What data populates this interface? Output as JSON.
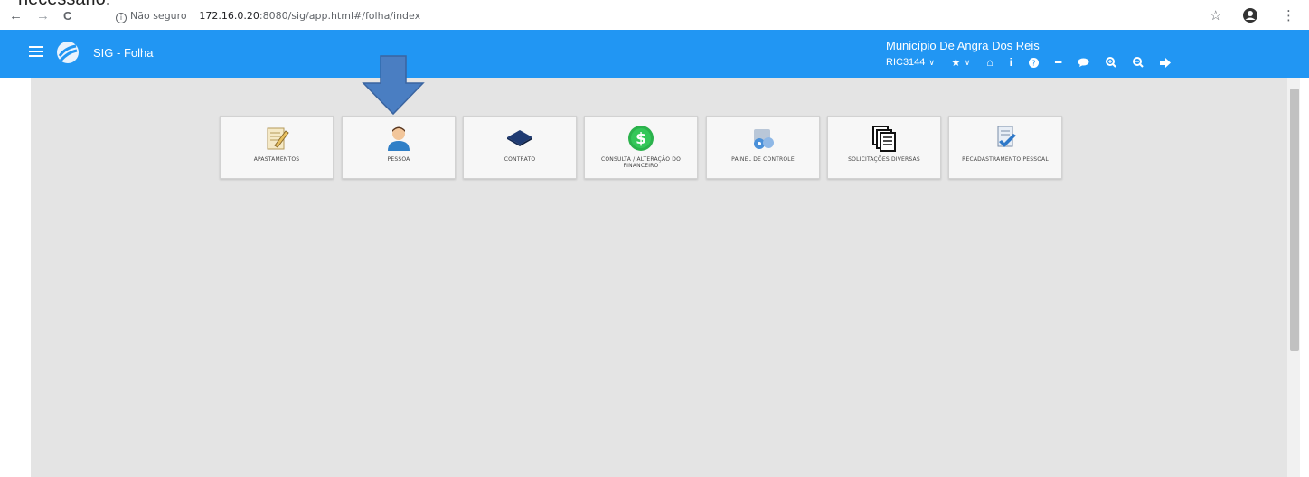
{
  "browser": {
    "nav": {
      "back": "←",
      "forward": "→",
      "reload": "C"
    },
    "security_label": "Não seguro",
    "url_host": "172.16.0.20",
    "url_rest": ":8080/sig/app.html#/folha/index",
    "bookmark_icon": "star-icon",
    "account_icon": "account-icon",
    "menu_glyph": "⋮"
  },
  "top_crop_text": "necessário:",
  "app": {
    "title": "SIG - Folha",
    "municipio": "Município De Angra Dos Reis",
    "user": "RIC3144",
    "brand_color": "#2196f3",
    "toolbar_icons": [
      "user-menu",
      "favorites-icon",
      "home-icon",
      "info-icon",
      "help-icon",
      "minus-icon",
      "chat-icon",
      "zoom-in-icon",
      "zoom-out-icon",
      "logout-icon"
    ]
  },
  "tiles": [
    {
      "label": "APASTAMENTOS",
      "icon": "document-pencil-icon"
    },
    {
      "label": "PESSOA",
      "icon": "person-icon"
    },
    {
      "label": "CONTRATO",
      "icon": "contract-book-icon"
    },
    {
      "label": "CONSULTA / ALTERAÇÃO DO FINANCEIRO",
      "icon": "dollar-coin-icon"
    },
    {
      "label": "PAINEL DE CONTROLE",
      "icon": "control-panel-icon"
    },
    {
      "label": "SOLICITAÇÕES DIVERSAS",
      "icon": "stacked-documents-icon"
    },
    {
      "label": "RECADASTRAMENTO PESSOAL",
      "icon": "document-check-icon"
    }
  ],
  "annotation": {
    "arrow_color": "#4a7ec2",
    "points_to": "PESSOA"
  }
}
